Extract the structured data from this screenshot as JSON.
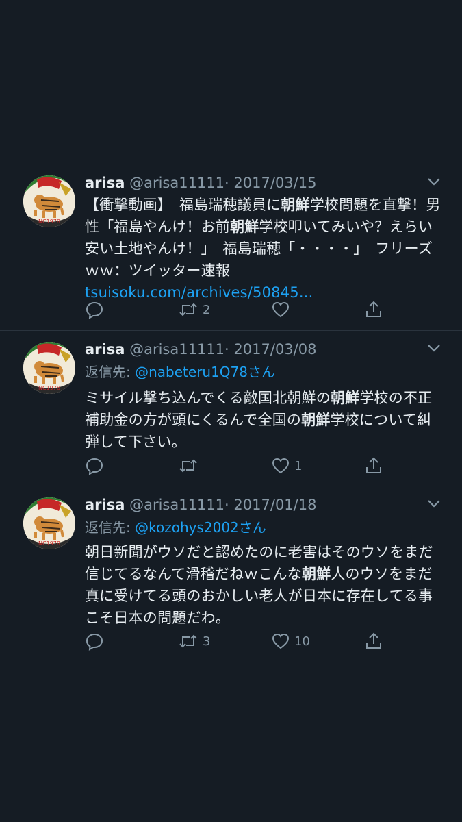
{
  "tweets": [
    {
      "name": "arisa",
      "handle": "@arisa11111",
      "separator": "·",
      "date": "2017/03/15",
      "reply_to_label": "",
      "reply_to_user": "",
      "body": {
        "p1": "【衝撃動画】　福島瑞穂議員に",
        "b1": "朝鮮",
        "p2": "学校問題を直撃！男性「福島やんけ！お前",
        "b2": "朝鮮",
        "p3": "学校叩いてみいや？えらい安い土地やんけ！」　福島瑞穂「・・・・」　フリーズｗｗ：ツイッター速報 ",
        "link": "tsuisoku.com/archives/50845..."
      },
      "retweets": "2",
      "likes": ""
    },
    {
      "name": "arisa",
      "handle": "@arisa11111",
      "separator": "·",
      "date": "2017/03/08",
      "reply_to_label": "返信先: ",
      "reply_to_user": "@nabeteru1Q78さん",
      "body": {
        "p1": "ミサイル撃ち込んでくる敵国北朝鮮の",
        "b1": "朝鮮",
        "p2": "学校の不正補助金の方が頭にくるんで全国の",
        "b2": "朝鮮",
        "p3": "学校について糾弾して下さい。",
        "link": ""
      },
      "retweets": "",
      "likes": "1"
    },
    {
      "name": "arisa",
      "handle": "@arisa11111",
      "separator": "·",
      "date": "2017/01/18",
      "reply_to_label": "返信先: ",
      "reply_to_user": "@kozohys2002さん",
      "body": {
        "p1": "朝日新聞がウソだと認めたのに老害はそのウソをまだ信じてるなんて滑稽だねｗこんな",
        "b1": "朝鮮",
        "p2": "人のウソをまだ真に受けてる頭のおかしい老人が日本に存在してる事こそ日本の問題だわ。",
        "b2": "",
        "p3": "",
        "link": ""
      },
      "retweets": "3",
      "likes": "10"
    }
  ],
  "avatar_text": "NC1978",
  "icons": {
    "reply": "reply-icon",
    "retweet": "retweet-icon",
    "like": "heart-icon",
    "share": "share-icon",
    "menu": "chevron-down-icon"
  },
  "colors": {
    "background": "#151c24",
    "text": "#e6ecf0",
    "muted": "#8899a6",
    "link": "#1da1f2",
    "divider": "#2a333d"
  }
}
